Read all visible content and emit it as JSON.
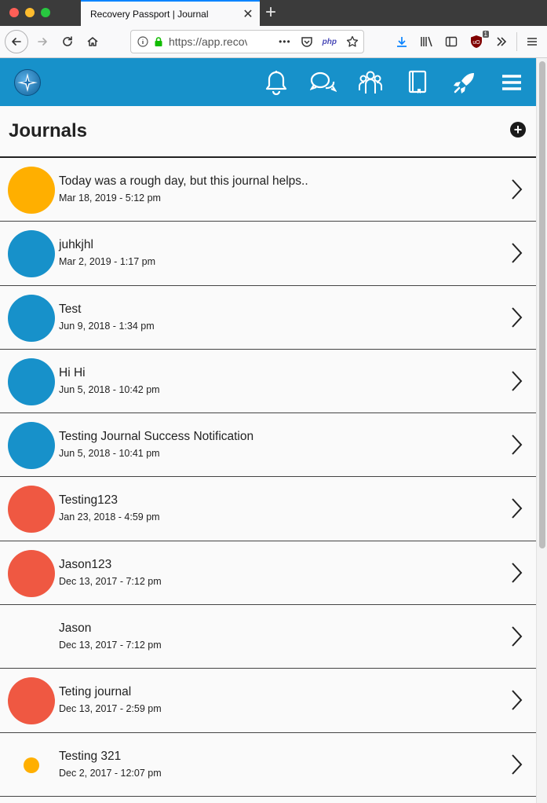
{
  "browser": {
    "tab_title": "Recovery Passport | Journal",
    "tab_close": "✕",
    "new_tab": "+",
    "url": "https://app.recovery",
    "more": "•••",
    "php_badge": "php",
    "extension_badge": "1"
  },
  "colors": {
    "brand": "#1791ca",
    "orange": "#ffaf00",
    "blue": "#1791ca",
    "red": "#ef5842"
  },
  "page": {
    "title": "Journals",
    "add": "+"
  },
  "journals": [
    {
      "title": "Today was a rough day, but this journal helps..",
      "date": "Mar 18, 2019 - 5:12 pm",
      "color": "#ffaf00",
      "size": "large"
    },
    {
      "title": "juhkjhl",
      "date": "Mar 2, 2019 - 1:17 pm",
      "color": "#1791ca",
      "size": "large"
    },
    {
      "title": "Test",
      "date": "Jun 9, 2018 - 1:34 pm",
      "color": "#1791ca",
      "size": "large"
    },
    {
      "title": "Hi Hi",
      "date": "Jun 5, 2018 - 10:42 pm",
      "color": "#1791ca",
      "size": "large"
    },
    {
      "title": "Testing Journal Success Notification",
      "date": "Jun 5, 2018 - 10:41 pm",
      "color": "#1791ca",
      "size": "large"
    },
    {
      "title": "Testing123",
      "date": "Jan 23, 2018 - 4:59 pm",
      "color": "#ef5842",
      "size": "large"
    },
    {
      "title": "Jason123",
      "date": "Dec 13, 2017 - 7:12 pm",
      "color": "#ef5842",
      "size": "large"
    },
    {
      "title": "Jason",
      "date": "Dec 13, 2017 - 7:12 pm",
      "color": "",
      "size": "none"
    },
    {
      "title": "Teting journal",
      "date": "Dec 13, 2017 - 2:59 pm",
      "color": "#ef5842",
      "size": "large"
    },
    {
      "title": "Testing 321",
      "date": "Dec 2, 2017 - 12:07 pm",
      "color": "#ffaf00",
      "size": "small"
    }
  ]
}
